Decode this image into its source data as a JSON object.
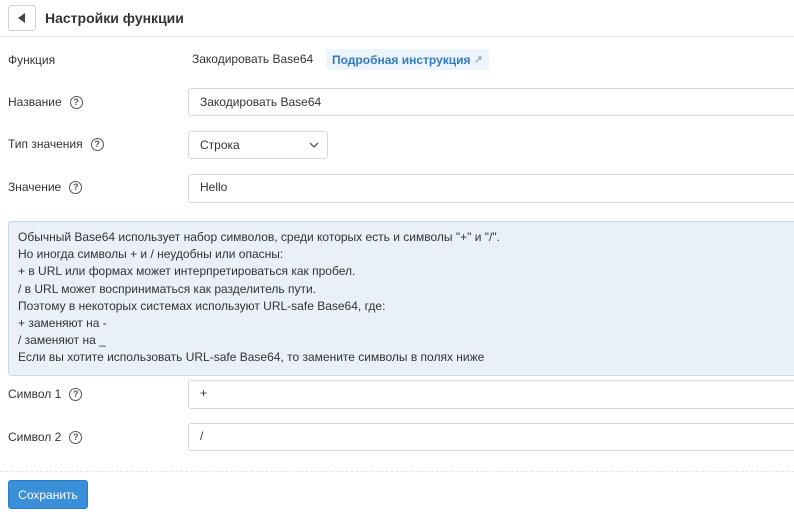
{
  "header": {
    "title": "Настройки функции"
  },
  "function_row": {
    "label": "Функция",
    "value": "Закодировать Base64",
    "doc_link": "Подробная инструкция",
    "doc_link_arrow": "↗"
  },
  "name_row": {
    "label": "Название",
    "value": "Закодировать Base64"
  },
  "type_row": {
    "label": "Тип значения",
    "selected": "Строка"
  },
  "value_row": {
    "label": "Значение",
    "value": "Hello"
  },
  "info": {
    "lines": [
      "Обычный Base64 использует набор символов, среди которых есть и символы \"+\" и \"/\".",
      "Но иногда символы + и / неудобны или опасны:",
      "+ в URL или формах может интерпретироваться как пробел.",
      "/ в URL может восприниматься как разделитель пути.",
      "Поэтому в некоторых системах используют URL-safe Base64, где:",
      "+ заменяют на -",
      "/ заменяют на _",
      "Если вы хотите использовать URL-safe Base64, то замените символы в полях ниже"
    ]
  },
  "symbol1_row": {
    "label": "Символ 1",
    "value": "+"
  },
  "symbol2_row": {
    "label": "Символ 2",
    "value": "/"
  },
  "help_glyph": "?",
  "footer": {
    "save_label": "Сохранить"
  }
}
